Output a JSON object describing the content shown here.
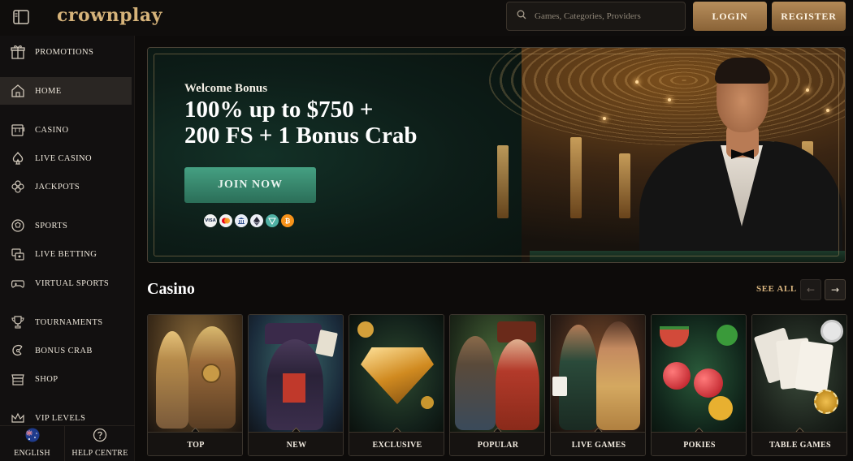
{
  "header": {
    "logo_text": "crownplay",
    "search_placeholder": "Games, Categories, Providers",
    "login_label": "LOGIN",
    "register_label": "REGISTER"
  },
  "sidebar": {
    "items": [
      {
        "label": "PROMOTIONS",
        "icon": "gift-icon"
      },
      {
        "label": "HOME",
        "icon": "home-icon",
        "active": true
      },
      {
        "label": "CASINO",
        "icon": "slot-machine-icon"
      },
      {
        "label": "LIVE CASINO",
        "icon": "spade-icon"
      },
      {
        "label": "JACKPOTS",
        "icon": "clover-icon"
      },
      {
        "label": "SPORTS",
        "icon": "soccer-ball-icon"
      },
      {
        "label": "LIVE BETTING",
        "icon": "live-tv-icon"
      },
      {
        "label": "VIRTUAL SPORTS",
        "icon": "gamepad-icon"
      },
      {
        "label": "TOURNAMENTS",
        "icon": "trophy-icon"
      },
      {
        "label": "BONUS CRAB",
        "icon": "claw-icon"
      },
      {
        "label": "SHOP",
        "icon": "shop-icon"
      },
      {
        "label": "VIP LEVELS",
        "icon": "crown-icon"
      }
    ],
    "footer": {
      "language_label": "ENGLISH",
      "help_label": "HELP CENTRE"
    }
  },
  "banner": {
    "subtitle": "Welcome Bonus",
    "title_line1": "100% up to $750 +",
    "title_line2": "200 FS + 1 Bonus Crab",
    "cta_label": "JOIN NOW",
    "payment_icons": [
      "VISA",
      "MC",
      "BANK",
      "ETH",
      "TRX",
      "BTC"
    ]
  },
  "casino": {
    "title": "Casino",
    "see_all_label": "SEE ALL",
    "prev_arrow": "←",
    "next_arrow": "→",
    "categories": [
      {
        "label": "TOP"
      },
      {
        "label": "NEW"
      },
      {
        "label": "EXCLUSIVE"
      },
      {
        "label": "POPULAR"
      },
      {
        "label": "LIVE GAMES"
      },
      {
        "label": "POKIES"
      },
      {
        "label": "TABLE GAMES"
      }
    ]
  },
  "colors": {
    "accent_gold": "#d8b47e",
    "button_gold": "#b78e5c",
    "join_green": "#3a8c70",
    "background": "#0d0b0a"
  }
}
